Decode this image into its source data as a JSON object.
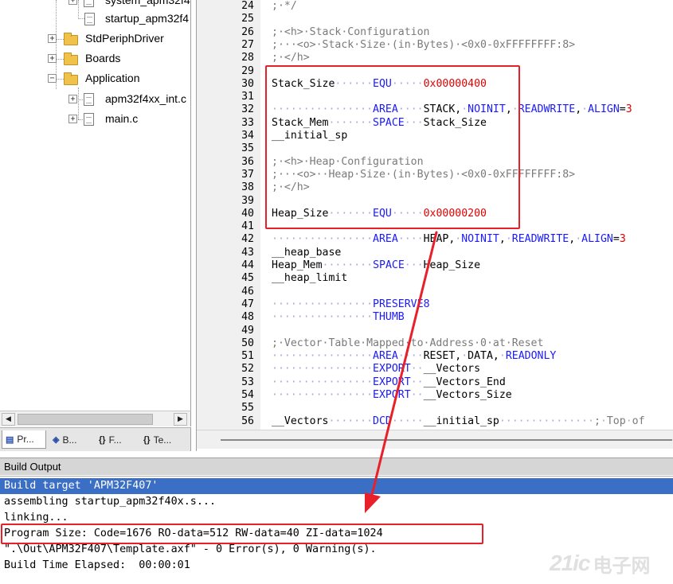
{
  "project_tree": {
    "items": [
      {
        "label": "system_apm32f4",
        "type": "file"
      },
      {
        "label": "startup_apm32f4",
        "type": "file"
      },
      {
        "label": "StdPeriphDriver",
        "type": "folder"
      },
      {
        "label": "Boards",
        "type": "folder"
      },
      {
        "label": "Application",
        "type": "folder"
      },
      {
        "label": "apm32f4xx_int.c",
        "type": "file"
      },
      {
        "label": "main.c",
        "type": "file"
      }
    ],
    "scroll_left": "◀",
    "scroll_right": "▶"
  },
  "panel_tabs": [
    {
      "label": "Pr...",
      "icon": "project-icon"
    },
    {
      "label": "B...",
      "icon": "books-icon"
    },
    {
      "label": "F...",
      "icon": "functions-icon"
    },
    {
      "label": "Te...",
      "icon": "templates-icon"
    }
  ],
  "editor": {
    "lines": [
      {
        "n": "24",
        "code": ";·*/"
      },
      {
        "n": "25",
        "code": ""
      },
      {
        "n": "26",
        "code": ";·<h>·Stack·Configuration"
      },
      {
        "n": "27",
        "code": ";···<o>·Stack·Size·(in·Bytes)·<0x0-0xFFFFFFFF:8>"
      },
      {
        "n": "28",
        "code": ";·</h>"
      },
      {
        "n": "29",
        "code": ""
      },
      {
        "n": "30",
        "code": "Stack_Size······EQU·····0x00000400"
      },
      {
        "n": "31",
        "code": ""
      },
      {
        "n": "32",
        "code": "················AREA····STACK,·NOINIT,·READWRITE,·ALIGN=3"
      },
      {
        "n": "33",
        "code": "Stack_Mem·······SPACE···Stack_Size"
      },
      {
        "n": "34",
        "code": "__initial_sp"
      },
      {
        "n": "35",
        "code": ""
      },
      {
        "n": "36",
        "code": ";·<h>·Heap·Configuration"
      },
      {
        "n": "37",
        "code": ";···<o>··Heap·Size·(in·Bytes)·<0x0-0xFFFFFFFF:8>"
      },
      {
        "n": "38",
        "code": ";·</h>"
      },
      {
        "n": "39",
        "code": ""
      },
      {
        "n": "40",
        "code": "Heap_Size·······EQU·····0x00000200"
      },
      {
        "n": "41",
        "code": ""
      },
      {
        "n": "42",
        "code": "················AREA····HEAP,·NOINIT,·READWRITE,·ALIGN=3"
      },
      {
        "n": "43",
        "code": "__heap_base"
      },
      {
        "n": "44",
        "code": "Heap_Mem········SPACE···Heap_Size"
      },
      {
        "n": "45",
        "code": "__heap_limit"
      },
      {
        "n": "46",
        "code": ""
      },
      {
        "n": "47",
        "code": "················PRESERVE8"
      },
      {
        "n": "48",
        "code": "················THUMB"
      },
      {
        "n": "49",
        "code": ""
      },
      {
        "n": "50",
        "code": ";·Vector·Table·Mapped·to·Address·0·at·Reset"
      },
      {
        "n": "51",
        "code": "················AREA····RESET,·DATA,·READONLY"
      },
      {
        "n": "52",
        "code": "················EXPORT··__Vectors"
      },
      {
        "n": "53",
        "code": "················EXPORT··__Vectors_End"
      },
      {
        "n": "54",
        "code": "················EXPORT··__Vectors_Size"
      },
      {
        "n": "55",
        "code": ""
      },
      {
        "n": "56",
        "code": "__Vectors·······DCD·····__initial_sp···············;·Top·of"
      }
    ]
  },
  "build_output": {
    "title": "Build Output",
    "lines": [
      "Build target 'APM32F407'",
      "assembling startup_apm32f40x.s...",
      "linking...",
      "Program Size: Code=1676 RO-data=512 RW-data=40 ZI-data=1024",
      "\".\\Out\\APM32F407\\Template.axf\" - 0 Error(s), 0 Warning(s).",
      "Build Time Elapsed:  00:00:01"
    ]
  },
  "watermark": {
    "logo": "21ic",
    "text": "电子网"
  },
  "colors": {
    "keyword": "#1a1aff",
    "number": "#e00000",
    "comment": "#7a7a7a",
    "selection": "#3a6fc5",
    "annotation": "#e8202a"
  }
}
